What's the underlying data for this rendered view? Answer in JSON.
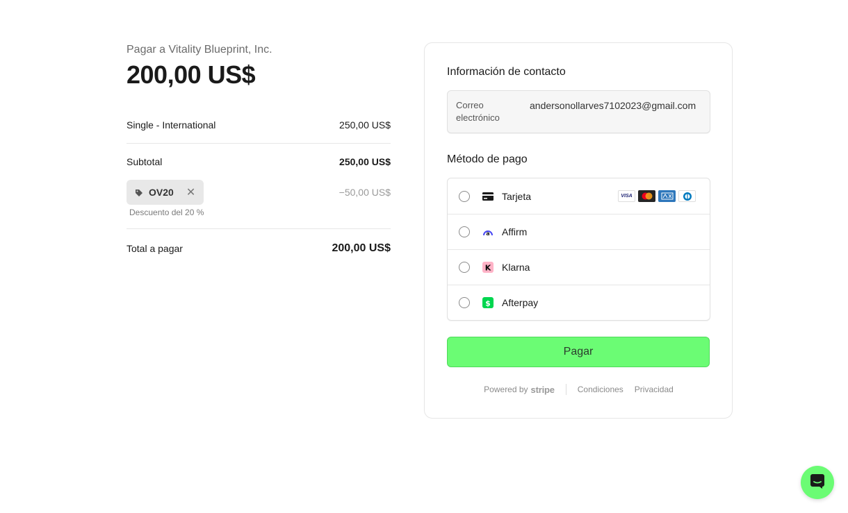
{
  "summary": {
    "pay_to": "Pagar a Vitality Blueprint, Inc.",
    "amount": "200,00 US$",
    "line_item": {
      "name": "Single - International",
      "price": "250,00 US$"
    },
    "subtotal_label": "Subtotal",
    "subtotal_value": "250,00 US$",
    "promo": {
      "code": "OV20",
      "discount_value": "−50,00 US$",
      "description": "Descuento del 20 %"
    },
    "total_label": "Total a pagar",
    "total_value": "200,00 US$"
  },
  "contact": {
    "title": "Información de contacto",
    "email_label": "Correo electrónico",
    "email_value": "andersonollarves7102023@gmail.com"
  },
  "payment": {
    "title": "Método de pago",
    "methods": [
      {
        "label": "Tarjeta",
        "icon": "card-icon"
      },
      {
        "label": "Affirm",
        "icon": "affirm-icon"
      },
      {
        "label": "Klarna",
        "icon": "klarna-icon"
      },
      {
        "label": "Afterpay",
        "icon": "afterpay-icon"
      }
    ],
    "brands": [
      "VISA",
      "Mastercard",
      "American Express",
      "Diners Club"
    ],
    "pay_button": "Pagar"
  },
  "footer": {
    "powered_by": "Powered by",
    "stripe": "stripe",
    "terms": "Condiciones",
    "privacy": "Privacidad"
  },
  "colors": {
    "accent": "#6bfc74",
    "text": "#1a1a1a",
    "muted": "#6b6b6b"
  }
}
